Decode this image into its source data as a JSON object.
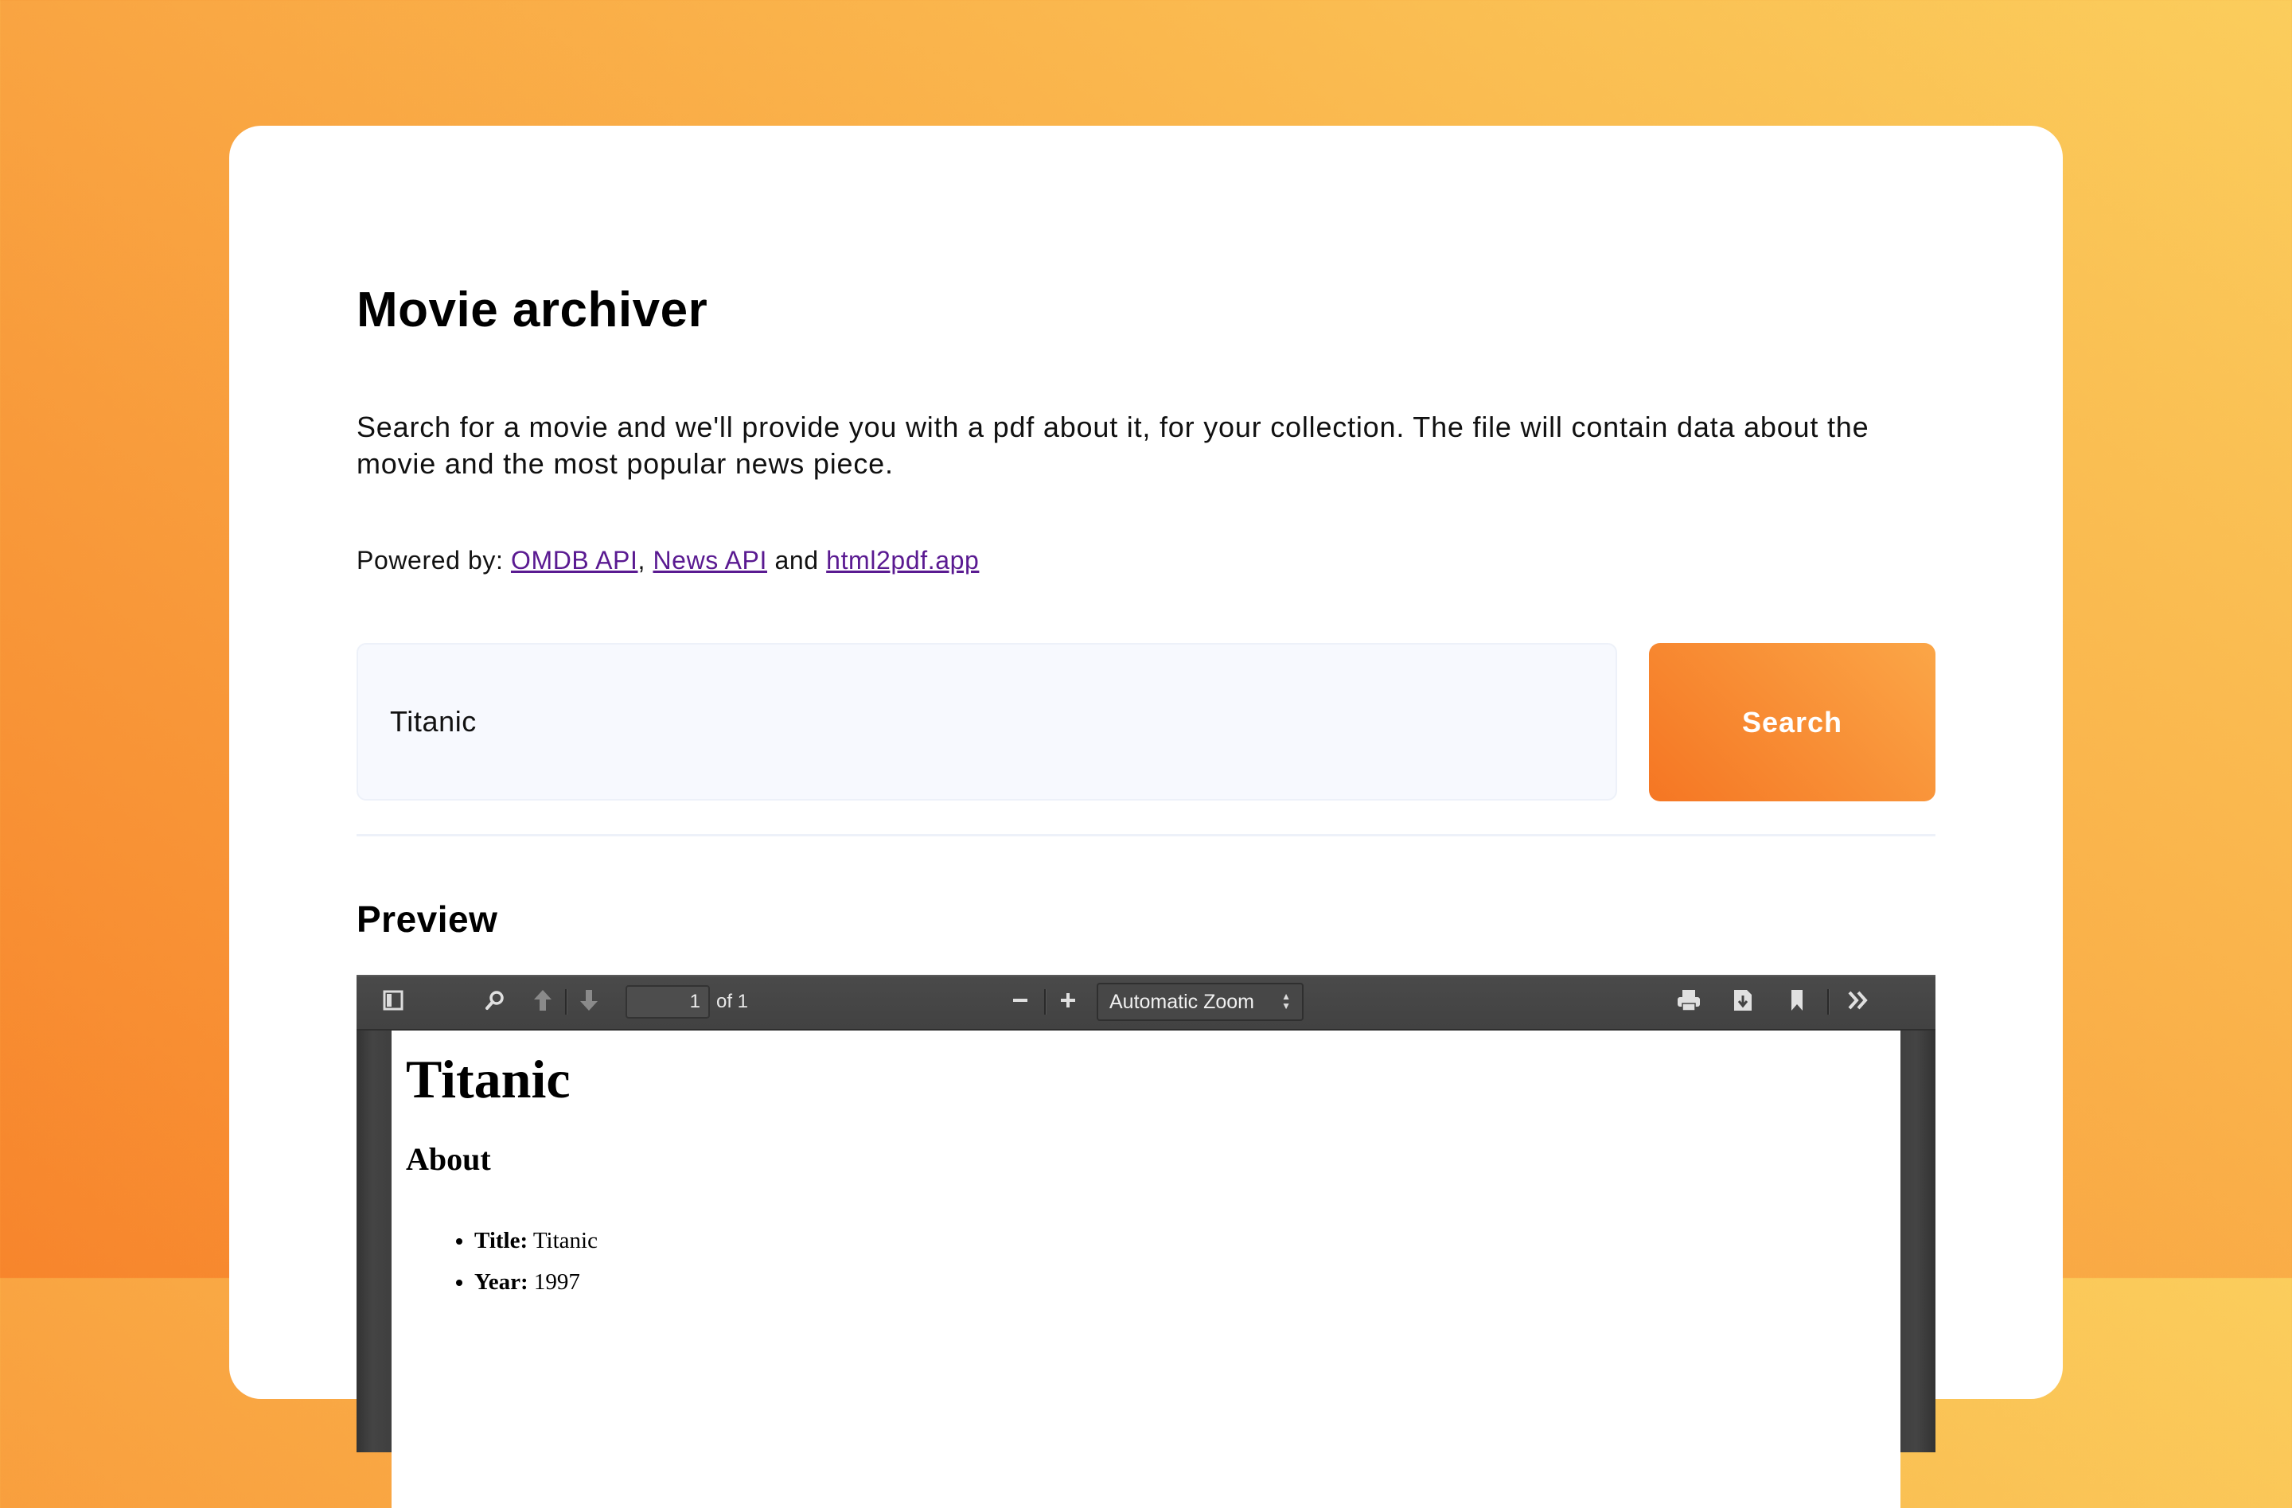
{
  "header": {
    "title": "Movie archiver",
    "description": "Search for a movie and we'll provide you with a pdf about it, for your collection. The file will contain data about the movie and the most popular news piece."
  },
  "powered_by": {
    "prefix": "Powered by: ",
    "links": [
      {
        "label": "OMDB API"
      },
      {
        "label": "News API"
      },
      {
        "label": "html2pdf.app"
      }
    ],
    "separator_1": ", ",
    "separator_2": " and "
  },
  "search": {
    "value": "Titanic",
    "placeholder": "",
    "button_label": "Search"
  },
  "preview": {
    "heading": "Preview",
    "viewer": {
      "toolbar": {
        "sidebar_toggle_icon": "sidebar-icon",
        "find_icon": "search-icon",
        "previous_icon": "arrow-up-icon",
        "next_icon": "arrow-down-icon",
        "page_number": "1",
        "page_count_label": "of 1",
        "zoom_out_icon": "minus-icon",
        "zoom_in_icon": "plus-icon",
        "zoom_select_value": "Automatic Zoom",
        "print_icon": "printer-icon",
        "download_icon": "download-icon",
        "bookmark_icon": "bookmark-icon",
        "tools_icon": "double-chevron-right-icon"
      },
      "document": {
        "title": "Titanic",
        "section_heading": "About",
        "items": [
          {
            "label": "Title:",
            "value": " Titanic"
          },
          {
            "label": "Year:",
            "value": " 1997"
          }
        ]
      }
    }
  },
  "colors": {
    "accent_start": "#f57623",
    "accent_end": "#fba647",
    "link": "#5a1a91",
    "input_bg": "#f7f9fe"
  }
}
